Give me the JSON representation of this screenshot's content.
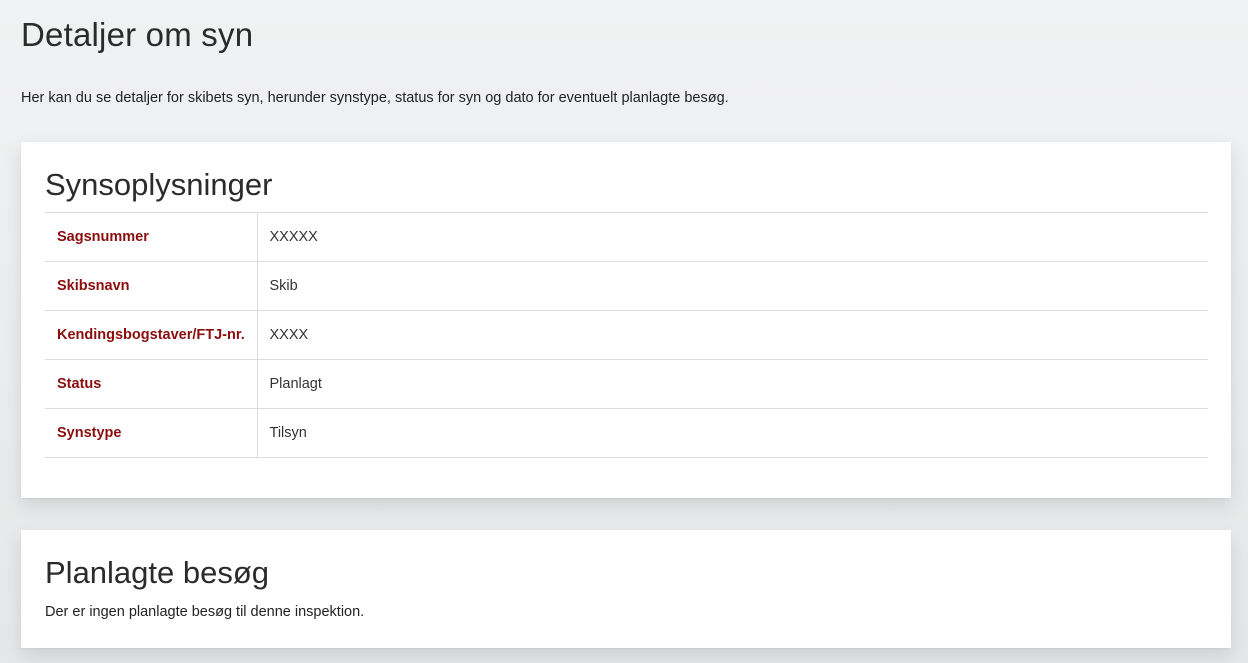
{
  "page": {
    "title": "Detaljer om syn",
    "intro": "Her kan du se detaljer for skibets syn, herunder synstype, status for syn og dato for eventuelt planlagte besøg."
  },
  "info_card": {
    "title": "Synsoplysninger",
    "rows": [
      {
        "label": "Sagsnummer",
        "value": "XXXXX"
      },
      {
        "label": "Skibsnavn",
        "value": "Skib"
      },
      {
        "label": "Kendingsbogstaver/FTJ-nr.",
        "value": "XXXX"
      },
      {
        "label": "Status",
        "value": "Planlagt"
      },
      {
        "label": "Synstype",
        "value": "Tilsyn"
      }
    ]
  },
  "visits_card": {
    "title": "Planlagte besøg",
    "text": "Der er ingen planlagte besøg til denne inspektion."
  },
  "colors": {
    "label_color": "#8b0e0e",
    "background": "#ecedee",
    "card": "#ffffff"
  }
}
